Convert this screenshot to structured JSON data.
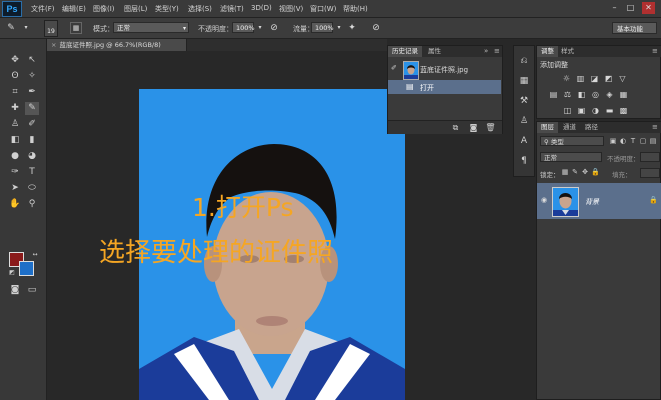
{
  "app": {
    "logo": "Ps"
  },
  "menu": [
    "文件(F)",
    "编辑(E)",
    "图像(I)",
    "图层(L)",
    "类型(Y)",
    "选择(S)",
    "滤镜(T)",
    "3D(D)",
    "视图(V)",
    "窗口(W)",
    "帮助(H)"
  ],
  "window_controls": {
    "minimize": "–",
    "maximize": "□",
    "close": "✕"
  },
  "options_bar": {
    "brush_size": "19",
    "mode_label": "模式：",
    "mode_value": "正常",
    "opacity_label": "不透明度：",
    "opacity_value": "100%",
    "flow_label": "流量：",
    "flow_value": "100%",
    "workspace": "基本功能"
  },
  "document": {
    "tab_title": "蓝底证件照.jpg @ 66.7%(RGB/8)",
    "close": "×"
  },
  "overlay": {
    "line1": "1.打开Ps",
    "line2": "选择要处理的证件照"
  },
  "history_panel": {
    "tabs": [
      "历史记录",
      "属性"
    ],
    "snapshot_name": "蓝底证件照.jpg",
    "steps": [
      "打开"
    ]
  },
  "adjustments_panel": {
    "tabs": [
      "调整",
      "样式"
    ],
    "title": "添加调整"
  },
  "layers_panel": {
    "tabs": [
      "图层",
      "通道",
      "路径"
    ],
    "filter_kind": "类型",
    "blend_mode": "正常",
    "opacity_label": "不透明度：",
    "lock_label": "锁定：",
    "fill_label": "填充：",
    "layers": [
      {
        "name": "背景"
      }
    ]
  },
  "colors": {
    "foreground": "#8a1a1a",
    "background": "#1e6fc8",
    "photo_backdrop": "#2a92e8",
    "overlay_text": "#f5a623",
    "selection": "#5b6f8c"
  }
}
